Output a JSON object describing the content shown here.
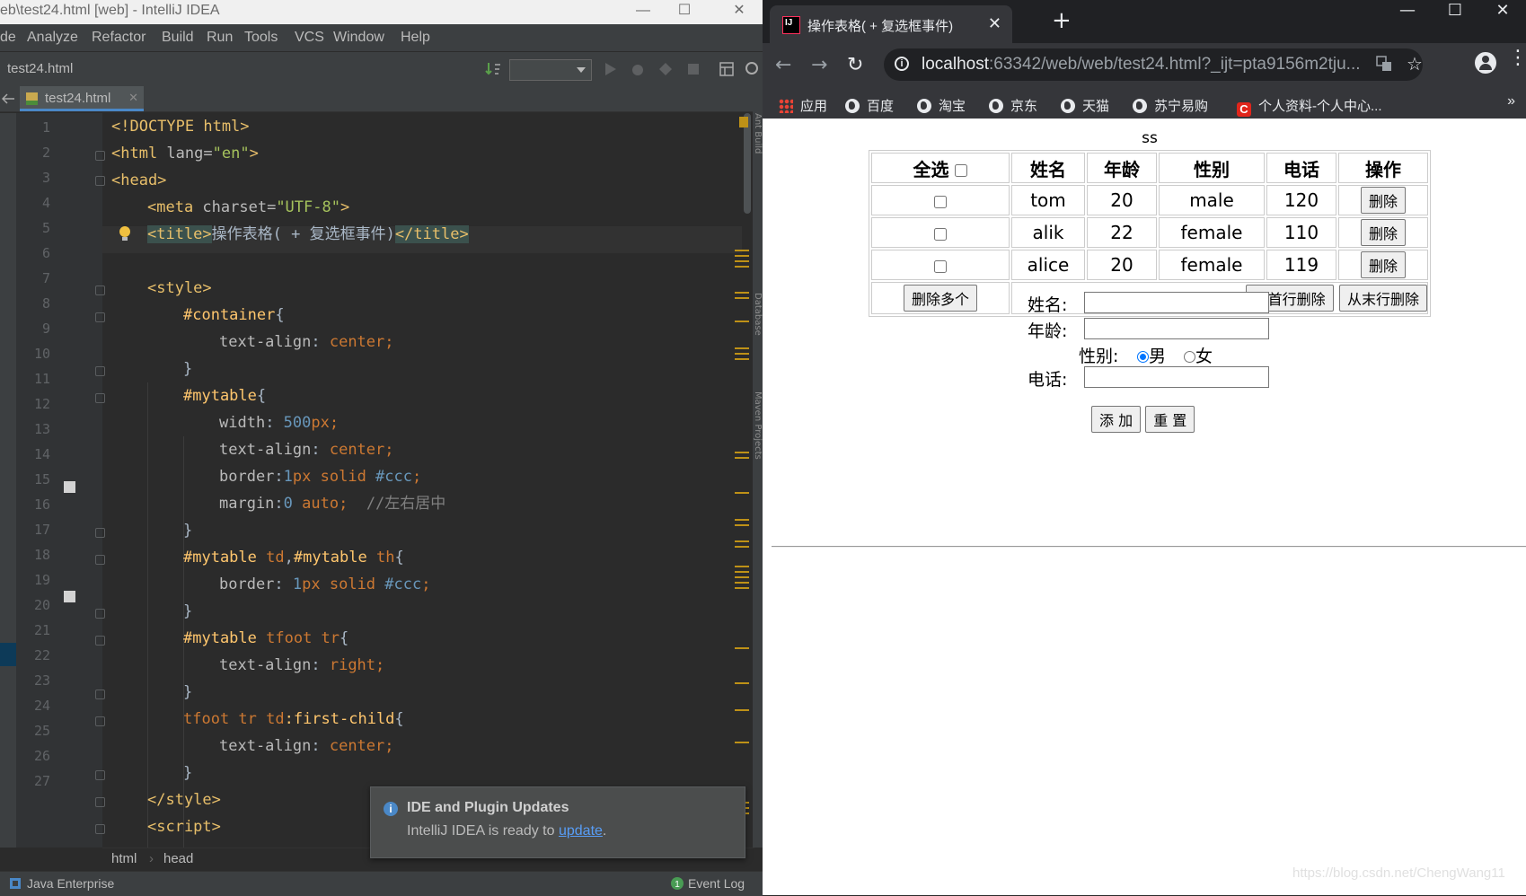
{
  "ide": {
    "title": "eb\\test24.html [web] - IntelliJ IDEA",
    "window_controls": {
      "min": "—",
      "max": "☐",
      "close": "✕"
    },
    "menu": [
      "de",
      "Analyze",
      "Refactor",
      "Build",
      "Run",
      "Tools",
      "VCS",
      "Window",
      "Help"
    ],
    "nav_crumb": "test24.html",
    "tab": {
      "label": "test24.html",
      "close": "✕"
    },
    "line_numbers": [
      "1",
      "2",
      "3",
      "4",
      "5",
      "6",
      "7",
      "8",
      "9",
      "10",
      "11",
      "12",
      "13",
      "14",
      "15",
      "16",
      "17",
      "18",
      "19",
      "20",
      "21",
      "22",
      "23",
      "24",
      "25",
      "26",
      "27"
    ],
    "code": {
      "l1": "<!DOCTYPE html>",
      "l2_tag": "<html ",
      "l2_attr": "lang=",
      "l2_str": "\"en\"",
      "l2_end": ">",
      "l3": "<head>",
      "l4_tag": "<meta ",
      "l4_attr": "charset=",
      "l4_str": "\"UTF-8\"",
      "l4_end": ">",
      "l5_open": "<title>",
      "l5_text": "操作表格( + 复选框事件)",
      "l5_close": "</title>",
      "l7": "<style>",
      "l8_sel": "#container",
      "l8_b": "{",
      "l9_prop": "text-align",
      "l9_colon": ": ",
      "l9_val": "center;",
      "l10": "}",
      "l11_sel": "#mytable",
      "l11_b": "{",
      "l12_prop": "width",
      "l12_colon": ": ",
      "l12_num": "500",
      "l12_val": "px;",
      "l13_prop": "text-align",
      "l13_colon": ": ",
      "l13_val": "center;",
      "l14_prop": "border",
      "l14_colon": ":",
      "l14_num": "1",
      "l14_val": "px solid ",
      "l14_col": "#ccc",
      "l14_end": ";",
      "l15_prop": "margin",
      "l15_colon": ":",
      "l15_num": "0",
      "l15_val": " auto;  ",
      "l15_cmt": "//左右居中",
      "l16": "}",
      "l17_sel1": "#mytable",
      "l17_t1": " td",
      "l17_c": ",",
      "l17_sel2": "#mytable",
      "l17_t2": " th",
      "l17_b": "{",
      "l18_prop": "border",
      "l18_colon": ": ",
      "l18_num": "1",
      "l18_val": "px solid ",
      "l18_col": "#ccc",
      "l18_end": ";",
      "l19": "}",
      "l20_sel": "#mytable",
      "l20_t": " tfoot tr",
      "l20_b": "{",
      "l21_prop": "text-align",
      "l21_colon": ": ",
      "l21_val": "right;",
      "l22": "}",
      "l23_t": "tfoot tr td",
      "l23_pseudo": ":first-child",
      "l23_b": "{",
      "l24_prop": "text-align",
      "l24_colon": ": ",
      "l24_val": "center;",
      "l25": "}",
      "l26": "</style>",
      "l27": "<script>"
    },
    "breadcrumb": [
      "html",
      "›",
      "head"
    ],
    "status": {
      "left": "Java Enterprise",
      "right": "Event Log",
      "event_count": "1"
    },
    "notification": {
      "title": "IDE and Plugin Updates",
      "body_prefix": "IntelliJ IDEA is ready to ",
      "link": "update",
      "body_suffix": ".",
      "icon": "i"
    },
    "side_tools": [
      "Ant Build",
      "Database",
      "Maven Projects"
    ]
  },
  "browser": {
    "tab_title": "操作表格( + 复选框事件)",
    "tab_close": "✕",
    "new_tab": "+",
    "window_controls": {
      "min": "—",
      "max": "☐",
      "close": "✕"
    },
    "nav": {
      "back": "←",
      "forward": "→",
      "reload": "↻"
    },
    "url_host": "localhost",
    "url_path": ":63342/web/web/test24.html?_ijt=pta9156m2tju...",
    "menu_dots": "⋮",
    "bookmarks": [
      "应用",
      "百度",
      "淘宝",
      "京东",
      "天猫",
      "苏宁易购",
      "个人资料-个人中心..."
    ],
    "bookmarks_more": "»",
    "page": {
      "heading": "ss",
      "headers": {
        "select_all": "全选",
        "name": "姓名",
        "age": "年龄",
        "gender": "性别",
        "phone": "电话",
        "op": "操作"
      },
      "rows": [
        {
          "name": "tom",
          "age": "20",
          "gender": "male",
          "phone": "120",
          "btn": "删除"
        },
        {
          "name": "alik",
          "age": "22",
          "gender": "female",
          "phone": "110",
          "btn": "删除"
        },
        {
          "name": "alice",
          "age": "20",
          "gender": "female",
          "phone": "119",
          "btn": "删除"
        }
      ],
      "footer": {
        "delete_many": "删除多个",
        "delete_first": "从首行删除",
        "delete_last": "从末行删除"
      },
      "form": {
        "name_label": "姓名:",
        "age_label": "年龄:",
        "gender_label": "性别:",
        "male": "男",
        "female": "女",
        "phone_label": "电话:",
        "add": "添 加",
        "reset": "重 置"
      }
    },
    "watermark": "https://blog.csdn.net/ChengWang11"
  }
}
